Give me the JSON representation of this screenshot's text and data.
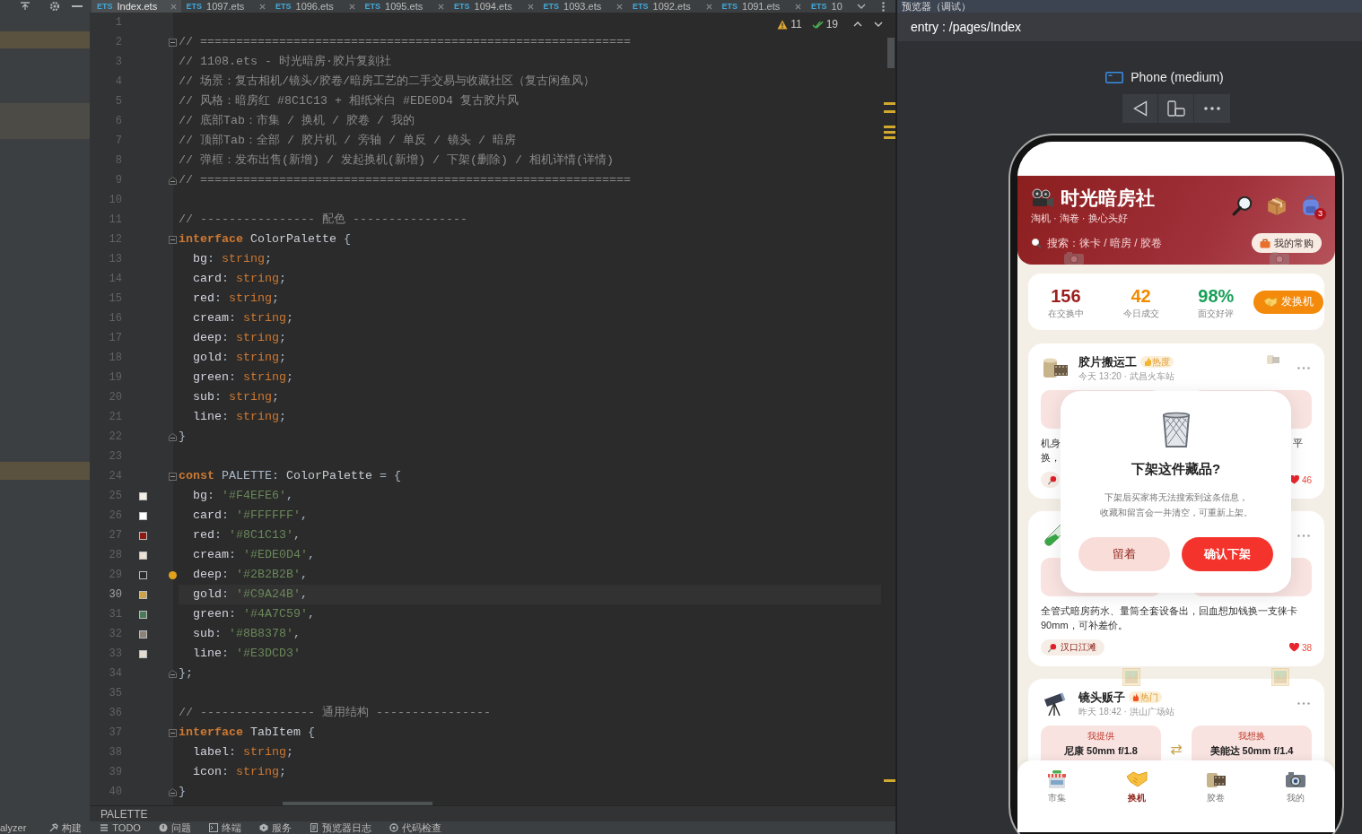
{
  "editor_tabs": [
    {
      "file_type": "ETS",
      "label": "Index.ets",
      "selected": true,
      "closable": true
    },
    {
      "file_type": "ETS",
      "label": "1097.ets",
      "selected": false,
      "closable": true
    },
    {
      "file_type": "ETS",
      "label": "1096.ets",
      "selected": false,
      "closable": true
    },
    {
      "file_type": "ETS",
      "label": "1095.ets",
      "selected": false,
      "closable": true
    },
    {
      "file_type": "ETS",
      "label": "1094.ets",
      "selected": false,
      "closable": true
    },
    {
      "file_type": "ETS",
      "label": "1093.ets",
      "selected": false,
      "closable": true
    },
    {
      "file_type": "ETS",
      "label": "1092.ets",
      "selected": false,
      "closable": true
    },
    {
      "file_type": "ETS",
      "label": "1091.ets",
      "selected": false,
      "closable": true
    },
    {
      "file_type": "ETS",
      "label": "10",
      "selected": false,
      "closable": false
    }
  ],
  "editor": {
    "inspections": {
      "warnings": "11",
      "passed": "19"
    },
    "lines": [
      {
        "number": "1",
        "kind": "plain",
        "current": false,
        "hint": false
      },
      {
        "number": "2",
        "kind": "opener",
        "current": false,
        "hint": false,
        "tokens": [
          {
            "text": "// ============================================================",
            "kind": "comment"
          }
        ]
      },
      {
        "number": "3",
        "kind": "plain",
        "current": false,
        "hint": false,
        "tokens": [
          {
            "text": "// 1108.ets - 时光暗房·胶片复刻社",
            "kind": "comment"
          }
        ]
      },
      {
        "number": "4",
        "kind": "plain",
        "current": false,
        "hint": false,
        "tokens": [
          {
            "text": "// 场景：复古相机/镜头/胶卷/暗房工艺的二手交易与收藏社区（复古闲鱼风）",
            "kind": "comment"
          }
        ]
      },
      {
        "number": "5",
        "kind": "plain",
        "current": false,
        "hint": false,
        "tokens": [
          {
            "text": "// 风格：暗房红 #8C1C13 + 相纸米白 #EDE0D4 复古胶片风",
            "kind": "comment"
          }
        ]
      },
      {
        "number": "6",
        "kind": "plain",
        "current": false,
        "hint": false,
        "tokens": [
          {
            "text": "// 底部Tab：市集 / 换机 / 胶卷 / 我的",
            "kind": "comment"
          }
        ]
      },
      {
        "number": "7",
        "kind": "plain",
        "current": false,
        "hint": false,
        "tokens": [
          {
            "text": "// 顶部Tab：全部 / 胶片机 / 旁轴 / 单反 / 镜头 / 暗房",
            "kind": "comment"
          }
        ]
      },
      {
        "number": "8",
        "kind": "plain",
        "current": false,
        "hint": false,
        "tokens": [
          {
            "text": "// 弹框：发布出售(新增) / 发起换机(新增) / 下架(删除) / 相机详情(详情)",
            "kind": "comment"
          }
        ]
      },
      {
        "number": "9",
        "kind": "closer",
        "current": false,
        "hint": false,
        "tokens": [
          {
            "text": "// ============================================================",
            "kind": "comment"
          }
        ]
      },
      {
        "number": "10",
        "kind": "plain",
        "current": false,
        "hint": false
      },
      {
        "number": "11",
        "kind": "plain",
        "current": false,
        "hint": false,
        "tokens": [
          {
            "text": "// ---------------- 配色 ----------------",
            "kind": "comment"
          }
        ]
      },
      {
        "number": "12",
        "kind": "opener",
        "current": false,
        "hint": false,
        "tokens": [
          {
            "text": "interface ",
            "kind": "keyword"
          },
          {
            "text": "ColorPalette",
            "kind": "name"
          },
          {
            "text": " {",
            "kind": "plain"
          }
        ]
      },
      {
        "number": "13",
        "kind": "plain",
        "current": false,
        "hint": false,
        "tokens": [
          {
            "text": "  bg",
            "kind": "field"
          },
          {
            "text": ": ",
            "kind": "plain"
          },
          {
            "text": "string",
            "kind": "builtin"
          },
          {
            "text": ";",
            "kind": "plain"
          }
        ]
      },
      {
        "number": "14",
        "kind": "plain",
        "current": false,
        "hint": false,
        "tokens": [
          {
            "text": "  card",
            "kind": "field"
          },
          {
            "text": ": ",
            "kind": "plain"
          },
          {
            "text": "string",
            "kind": "builtin"
          },
          {
            "text": ";",
            "kind": "plain"
          }
        ]
      },
      {
        "number": "15",
        "kind": "plain",
        "current": false,
        "hint": false,
        "tokens": [
          {
            "text": "  red",
            "kind": "field"
          },
          {
            "text": ": ",
            "kind": "plain"
          },
          {
            "text": "string",
            "kind": "builtin"
          },
          {
            "text": ";",
            "kind": "plain"
          }
        ]
      },
      {
        "number": "16",
        "kind": "plain",
        "current": false,
        "hint": false,
        "tokens": [
          {
            "text": "  cream",
            "kind": "field"
          },
          {
            "text": ": ",
            "kind": "plain"
          },
          {
            "text": "string",
            "kind": "builtin"
          },
          {
            "text": ";",
            "kind": "plain"
          }
        ]
      },
      {
        "number": "17",
        "kind": "plain",
        "current": false,
        "hint": false,
        "tokens": [
          {
            "text": "  deep",
            "kind": "field"
          },
          {
            "text": ": ",
            "kind": "plain"
          },
          {
            "text": "string",
            "kind": "builtin"
          },
          {
            "text": ";",
            "kind": "plain"
          }
        ]
      },
      {
        "number": "18",
        "kind": "plain",
        "current": false,
        "hint": false,
        "tokens": [
          {
            "text": "  gold",
            "kind": "field"
          },
          {
            "text": ": ",
            "kind": "plain"
          },
          {
            "text": "string",
            "kind": "builtin"
          },
          {
            "text": ";",
            "kind": "plain"
          }
        ]
      },
      {
        "number": "19",
        "kind": "plain",
        "current": false,
        "hint": false,
        "tokens": [
          {
            "text": "  green",
            "kind": "field"
          },
          {
            "text": ": ",
            "kind": "plain"
          },
          {
            "text": "string",
            "kind": "builtin"
          },
          {
            "text": ";",
            "kind": "plain"
          }
        ]
      },
      {
        "number": "20",
        "kind": "plain",
        "current": false,
        "hint": false,
        "tokens": [
          {
            "text": "  sub",
            "kind": "field"
          },
          {
            "text": ": ",
            "kind": "plain"
          },
          {
            "text": "string",
            "kind": "builtin"
          },
          {
            "text": ";",
            "kind": "plain"
          }
        ]
      },
      {
        "number": "21",
        "kind": "plain",
        "current": false,
        "hint": false,
        "tokens": [
          {
            "text": "  line",
            "kind": "field"
          },
          {
            "text": ": ",
            "kind": "plain"
          },
          {
            "text": "string",
            "kind": "builtin"
          },
          {
            "text": ";",
            "kind": "plain"
          }
        ]
      },
      {
        "number": "22",
        "kind": "closer",
        "current": false,
        "hint": false,
        "tokens": [
          {
            "text": "}",
            "kind": "plain"
          }
        ]
      },
      {
        "number": "23",
        "kind": "plain",
        "current": false,
        "hint": false
      },
      {
        "number": "24",
        "kind": "opener",
        "current": false,
        "hint": false,
        "tokens": [
          {
            "text": "const ",
            "kind": "keyword"
          },
          {
            "text": "PALETTE",
            "kind": "plain"
          },
          {
            "text": ": ",
            "kind": "plain"
          },
          {
            "text": "ColorPalette",
            "kind": "name"
          },
          {
            "text": " = {",
            "kind": "plain"
          }
        ]
      },
      {
        "number": "25",
        "kind": "plain",
        "current": false,
        "hint": false,
        "color": "#F4EFE6",
        "tokens": [
          {
            "text": "  bg",
            "kind": "field"
          },
          {
            "text": ": ",
            "kind": "plain"
          },
          {
            "text": "'#F4EFE6'",
            "kind": "string"
          },
          {
            "text": ",",
            "kind": "plain"
          }
        ]
      },
      {
        "number": "26",
        "kind": "plain",
        "current": false,
        "hint": false,
        "color": "#FFFFFF",
        "tokens": [
          {
            "text": "  card",
            "kind": "field"
          },
          {
            "text": ": ",
            "kind": "plain"
          },
          {
            "text": "'#FFFFFF'",
            "kind": "string"
          },
          {
            "text": ",",
            "kind": "plain"
          }
        ]
      },
      {
        "number": "27",
        "kind": "plain",
        "current": false,
        "hint": false,
        "color": "#8C1C13",
        "tokens": [
          {
            "text": "  red",
            "kind": "field"
          },
          {
            "text": ": ",
            "kind": "plain"
          },
          {
            "text": "'#8C1C13'",
            "kind": "string"
          },
          {
            "text": ",",
            "kind": "plain"
          }
        ]
      },
      {
        "number": "28",
        "kind": "plain",
        "current": false,
        "hint": false,
        "color": "#EDE0D4",
        "tokens": [
          {
            "text": "  cream",
            "kind": "field"
          },
          {
            "text": ": ",
            "kind": "plain"
          },
          {
            "text": "'#EDE0D4'",
            "kind": "string"
          },
          {
            "text": ",",
            "kind": "plain"
          }
        ]
      },
      {
        "number": "29",
        "kind": "plain",
        "current": false,
        "hint": true,
        "color": "#2B2B2B",
        "tokens": [
          {
            "text": "  deep",
            "kind": "field"
          },
          {
            "text": ": ",
            "kind": "plain"
          },
          {
            "text": "'#2B2B2B'",
            "kind": "string"
          },
          {
            "text": ",",
            "kind": "plain"
          }
        ]
      },
      {
        "number": "30",
        "kind": "plain",
        "current": true,
        "hint": false,
        "color": "#C9A24B",
        "tokens": [
          {
            "text": "  gold",
            "kind": "field"
          },
          {
            "text": ": ",
            "kind": "plain"
          },
          {
            "text": "'#C9A24B'",
            "kind": "string"
          },
          {
            "text": ",",
            "kind": "plain"
          }
        ]
      },
      {
        "number": "31",
        "kind": "plain",
        "current": false,
        "hint": false,
        "color": "#4A7C59",
        "tokens": [
          {
            "text": "  green",
            "kind": "field"
          },
          {
            "text": ": ",
            "kind": "plain"
          },
          {
            "text": "'#4A7C59'",
            "kind": "string"
          },
          {
            "text": ",",
            "kind": "plain"
          }
        ]
      },
      {
        "number": "32",
        "kind": "plain",
        "current": false,
        "hint": false,
        "color": "#8B8378",
        "tokens": [
          {
            "text": "  sub",
            "kind": "field"
          },
          {
            "text": ": ",
            "kind": "plain"
          },
          {
            "text": "'#8B8378'",
            "kind": "string"
          },
          {
            "text": ",",
            "kind": "plain"
          }
        ]
      },
      {
        "number": "33",
        "kind": "plain",
        "current": false,
        "hint": false,
        "color": "#E3DCD3",
        "tokens": [
          {
            "text": "  line",
            "kind": "field"
          },
          {
            "text": ": ",
            "kind": "plain"
          },
          {
            "text": "'#E3DCD3'",
            "kind": "string"
          }
        ]
      },
      {
        "number": "34",
        "kind": "closer",
        "current": false,
        "hint": false,
        "tokens": [
          {
            "text": "};",
            "kind": "plain"
          }
        ]
      },
      {
        "number": "35",
        "kind": "plain",
        "current": false,
        "hint": false
      },
      {
        "number": "36",
        "kind": "plain",
        "current": false,
        "hint": false,
        "tokens": [
          {
            "text": "// ---------------- 通用结构 ----------------",
            "kind": "comment"
          }
        ]
      },
      {
        "number": "37",
        "kind": "opener",
        "current": false,
        "hint": false,
        "tokens": [
          {
            "text": "interface ",
            "kind": "keyword"
          },
          {
            "text": "TabItem",
            "kind": "name"
          },
          {
            "text": " {",
            "kind": "plain"
          }
        ]
      },
      {
        "number": "38",
        "kind": "plain",
        "current": false,
        "hint": false,
        "tokens": [
          {
            "text": "  label",
            "kind": "field"
          },
          {
            "text": ": ",
            "kind": "plain"
          },
          {
            "text": "string",
            "kind": "builtin"
          },
          {
            "text": ";",
            "kind": "plain"
          }
        ]
      },
      {
        "number": "39",
        "kind": "plain",
        "current": false,
        "hint": false,
        "tokens": [
          {
            "text": "  icon",
            "kind": "field"
          },
          {
            "text": ": ",
            "kind": "plain"
          },
          {
            "text": "string",
            "kind": "builtin"
          },
          {
            "text": ";",
            "kind": "plain"
          }
        ]
      },
      {
        "number": "40",
        "kind": "closer",
        "current": false,
        "hint": false,
        "tokens": [
          {
            "text": "}",
            "kind": "plain"
          }
        ]
      }
    ],
    "breadcrumb": "PALETTE"
  },
  "preview": {
    "panel_title": "预览器（调试）",
    "route": "entry : /pages/Index",
    "device": "Phone (medium)",
    "app": {
      "title": "时光暗房社",
      "subtitle": "淘机 · 淘卷 · 换心头好",
      "cart_badge": "3",
      "search": {
        "placeholder": "搜索：徕卡 / 暗房 / 胶卷"
      },
      "frequent_button": "我的常购",
      "stats": [
        {
          "value": "156",
          "label": "在交换中",
          "color": "#9C1F1F"
        },
        {
          "value": "42",
          "label": "今日成交",
          "color": "#F28A00"
        },
        {
          "value": "98%",
          "label": "面交好评",
          "color": "#18A058"
        }
      ],
      "post_button": "发换机",
      "posts": [
        {
          "kind": "photos",
          "user": "胶片搬运工",
          "tag": "热度",
          "time": "今天 13:20 · 武昌火车站",
          "text_fragments": [
            {
              "start": "机身",
              "end": "平"
            },
            {
              "start": "换，"
            }
          ],
          "likes": "46"
        },
        {
          "kind": "photos",
          "text": "全管式暗房药水、量筒全套设备出，回血想加钱换一支徕卡90mm，可补差价。",
          "location": "汉口江滩",
          "likes": "38"
        },
        {
          "kind": "swap",
          "user": "镜头贩子",
          "tag": "热门",
          "time": "昨天 18:42 · 洪山广场站",
          "offer": {
            "label": "我提供",
            "item": "尼康 50mm f/1.8"
          },
          "swap_sign": "⇄",
          "want": {
            "label": "我想换",
            "item": "美能达 50mm f/1.4"
          }
        }
      ],
      "dialog": {
        "title": "下架这件藏品?",
        "message_lines": [
          "下架后买家将无法搜索到这条信息，",
          "收藏和留言会一并清空，可重新上架。"
        ],
        "buttons": [
          {
            "label": "留着",
            "kind": "secondary"
          },
          {
            "label": "确认下架",
            "kind": "primary"
          }
        ]
      },
      "nav": [
        {
          "label": "市集",
          "selected": false
        },
        {
          "label": "换机",
          "selected": true
        },
        {
          "label": "胶卷",
          "selected": false
        },
        {
          "label": "我的",
          "selected": false
        }
      ]
    }
  },
  "tool_windows": [
    "alyzer",
    "构建",
    "TODO",
    "问题",
    "终端",
    "服务",
    "预览器日志",
    "代码检查"
  ]
}
